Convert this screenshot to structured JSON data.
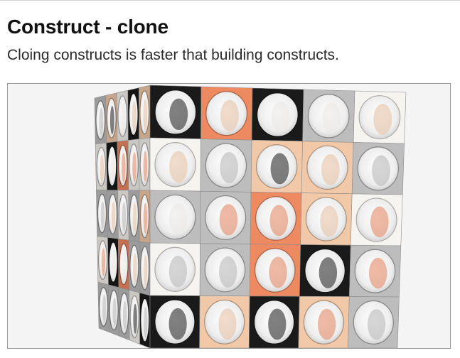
{
  "header": {
    "title": "Construct - clone",
    "subtitle": "Cloing constructs is faster that building constructs."
  },
  "scene": {
    "description_icon": "cube-lattice-render",
    "background_color": "#f4f4f4",
    "border_color": "#9a9a9a",
    "palette": {
      "white": "#f6f4f0",
      "peach": "#f1c9a8",
      "coral": "#ee8a62",
      "gray": "#bdbdbd",
      "dark": "#1a1a1a"
    }
  }
}
